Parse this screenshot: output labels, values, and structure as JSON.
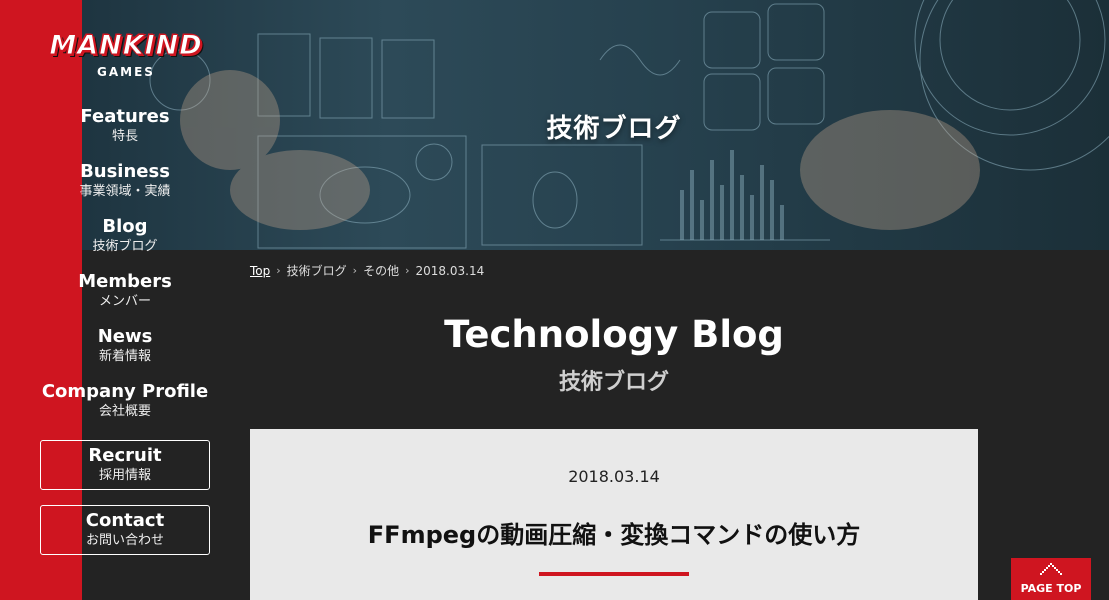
{
  "hero": {
    "title": "技術ブログ"
  },
  "logo": {
    "brand": "MANKIND",
    "sub": "GAMES"
  },
  "nav": {
    "items": [
      {
        "en": "Features",
        "jp": "特長"
      },
      {
        "en": "Business",
        "jp": "事業領域・実績"
      },
      {
        "en": "Blog",
        "jp": "技術ブログ"
      },
      {
        "en": "Members",
        "jp": "メンバー"
      },
      {
        "en": "News",
        "jp": "新着情報"
      },
      {
        "en": "Company Profile",
        "jp": "会社概要"
      }
    ],
    "recruit": {
      "en": "Recruit",
      "jp": "採用情報"
    },
    "contact": {
      "en": "Contact",
      "jp": "お問い合わせ"
    }
  },
  "breadcrumb": {
    "items": [
      "Top",
      "技術ブログ",
      "その他",
      "2018.03.14"
    ]
  },
  "section": {
    "title": "Technology Blog",
    "subtitle": "技術ブログ"
  },
  "article": {
    "date": "2018.03.14",
    "title": "FFmpegの動画圧縮・変換コマンドの使い方"
  },
  "page_top": {
    "label": "PAGE TOP"
  },
  "colors": {
    "accent": "#cf1520",
    "background": "#232323",
    "card": "#e9e9e9"
  }
}
